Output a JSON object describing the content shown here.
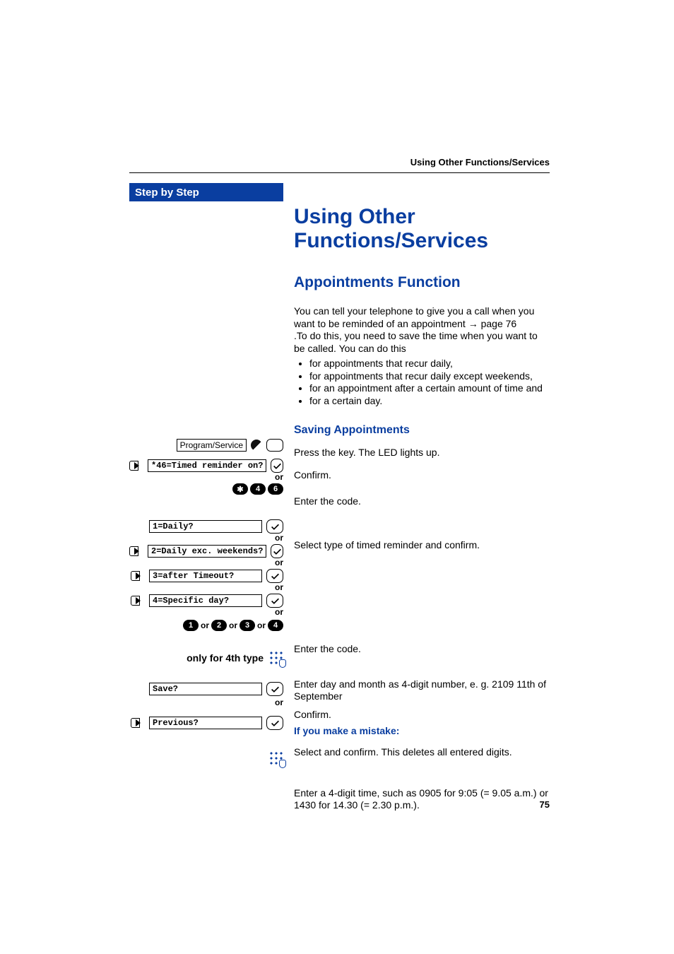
{
  "running_head": "Using Other Functions/Services",
  "sidebar_title": "Step by Step",
  "page_number": "75",
  "h1": "Using Other Functions/Services",
  "h2": "Appointments Function",
  "intro_line1": "You can tell your telephone to give you a call when you want to be reminded of an appointment ",
  "intro_arrow": "→",
  "intro_pageref": " page 76",
  "intro_line2": ".To do this, you need to save the time when you want to be called. You can do this",
  "bullets": [
    "for appointments that recur daily,",
    "for appointments that recur daily except weekends,",
    "for an appointment after a certain amount of time and",
    "for a certain day."
  ],
  "h3": "Saving Appointments",
  "left": {
    "program_service": "Program/Service",
    "lcd_reminder": "*46=Timed reminder on?",
    "or": "or",
    "code_keys": [
      "✱",
      "4",
      "6"
    ],
    "opt1": "1=Daily?",
    "opt2": "2=Daily exc. weekends?",
    "opt3": "3=after Timeout?",
    "opt4": "4=Specific day?",
    "type_code_keys": [
      "1",
      "2",
      "3",
      "4"
    ],
    "type_code_sep": "or",
    "only4th": "only for 4th type",
    "save": "Save?",
    "previous": "Previous?"
  },
  "steps": {
    "press_key": "Press the key. The LED lights up.",
    "confirm1": "Confirm.",
    "enter_code1": "Enter the code.",
    "select_type": "Select type of timed reminder and confirm.",
    "enter_code2": "Enter the code.",
    "enter_daymonth": "Enter day and month as 4-digit number, e. g. 2109 11th of September",
    "confirm2": "Confirm.",
    "mistake_label": "If you make a mistake:",
    "select_delete": "Select and confirm. This deletes all entered digits.",
    "enter_time": "Enter a 4-digit time, such as 0905 for 9:05 (= 9.05 a.m.) or 1430 for 14.30 (= 2.30 p.m.)."
  }
}
